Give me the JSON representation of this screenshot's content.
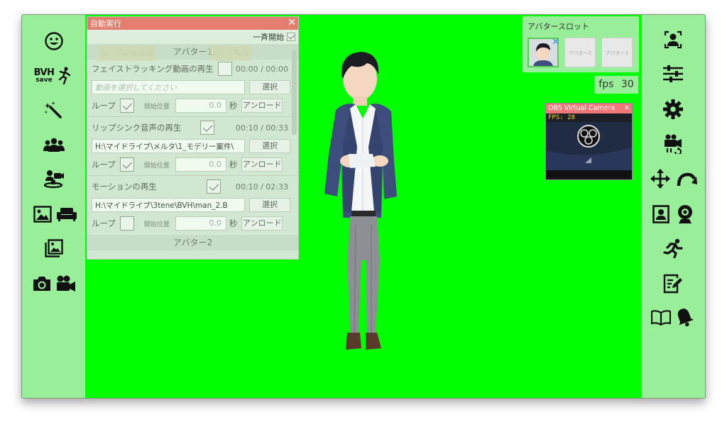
{
  "left_sidebar": {
    "bvh_label": "BVH",
    "save_label": "save",
    "icons": [
      "face-icon",
      "bvh-save-icon",
      "magic-wand-icon",
      "people-icon",
      "avatar-camera-icon",
      "image-icon",
      "sofa-icon",
      "background-image-icon",
      "camera-icon",
      "video-camera-icon"
    ]
  },
  "right_sidebar": {
    "icons": [
      "face-tracking-icon",
      "sliders-icon",
      "gear-icon",
      "camera-rotate-icon",
      "move-icon",
      "redo-icon",
      "portrait-icon",
      "webcam-icon",
      "running-icon",
      "edit-note-icon",
      "book-icon",
      "bell-icon"
    ]
  },
  "auto_panel": {
    "title": "自動実行",
    "close": "✕",
    "start_all_label": "一斉開始",
    "start_all_checked": true,
    "section1_label": "アバター1",
    "ghost_left": "ループにちらほ",
    "ghost_right": "ほにこちら",
    "face_tracking": {
      "label": "フェイストラッキング動画の再生",
      "time": "00:00 / 00:00",
      "placeholder": "動画を選択してください",
      "select_button": "選択",
      "loop_label": "ループ",
      "loop_checked": true,
      "start_pos_label": "開始位置",
      "start_pos_value": "0.0",
      "unit": "秒",
      "unload_button": "アンロード"
    },
    "lipsync": {
      "label": "リップシンク音声の再生",
      "checked": true,
      "time": "00:10 / 00:33",
      "path": "H:\\マイドライブ\\メルタ\\1_モデリー案件\\",
      "select_button": "選択",
      "loop_label": "ループ",
      "loop_checked": true,
      "start_pos_label": "開始位置",
      "start_pos_value": "0.0",
      "unit": "秒",
      "unload_button": "アンロード"
    },
    "motion": {
      "label": "モーションの再生",
      "checked": true,
      "time": "00:10 / 02:33",
      "path": "H:\\マイドライブ\\3tene\\BVH\\man_2.B",
      "select_button": "選択",
      "loop_label": "ループ",
      "loop_checked": false,
      "start_pos_label": "開始位置",
      "start_pos_value": "0.0",
      "unit": "秒",
      "unload_button": "アンロード"
    },
    "section2_label": "アバター2"
  },
  "avatar_slot": {
    "title": "アバタースロット",
    "slots": [
      "アバター2",
      "アバター3"
    ]
  },
  "fps": {
    "label": "fps",
    "value": "30"
  },
  "obs": {
    "title": "OBS Virtual Camera",
    "close": "✕",
    "fps_text": "FPS: 28"
  },
  "colors": {
    "chroma_green": "#00ff00",
    "sidebar_green": "#99ee99",
    "title_red": "#f07878"
  }
}
